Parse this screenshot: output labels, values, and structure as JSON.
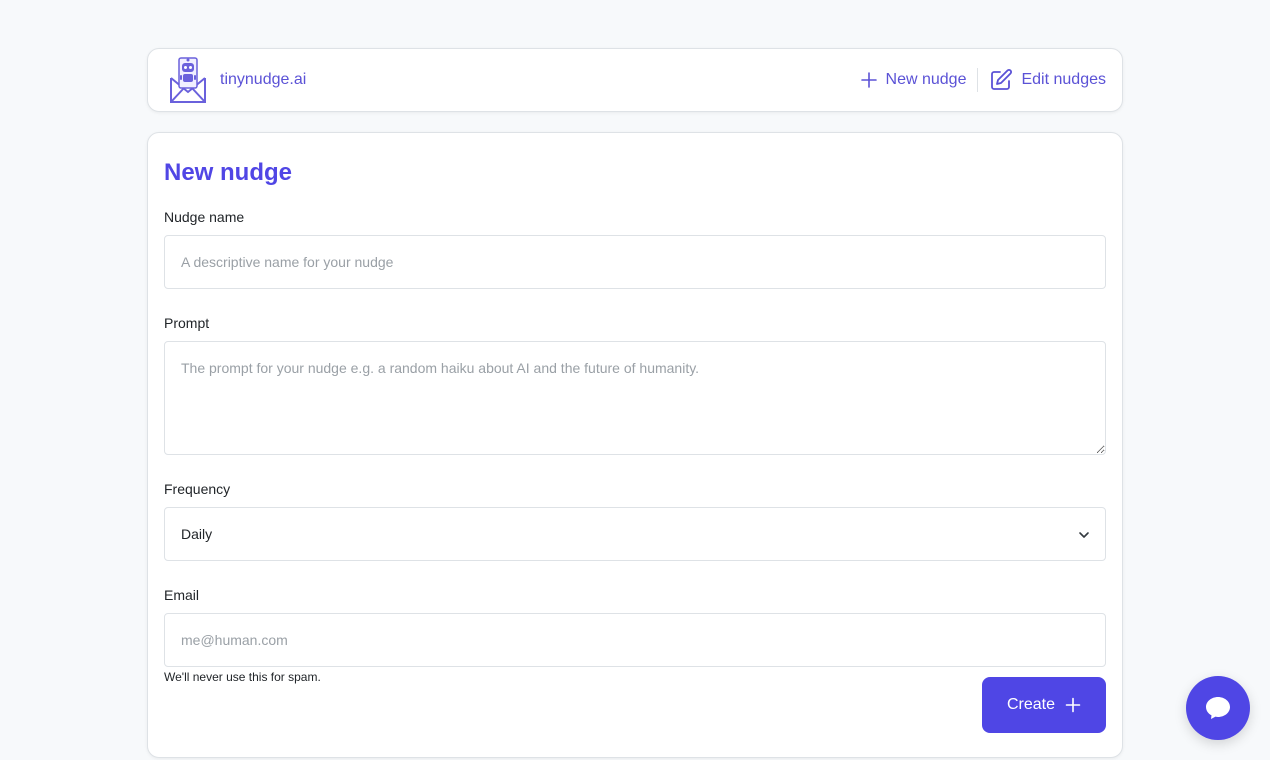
{
  "brand": {
    "name": "tinynudge.ai",
    "logo_icon": "robot-envelope-icon"
  },
  "nav": {
    "new_nudge": "New nudge",
    "edit_nudges": "Edit nudges"
  },
  "form": {
    "title": "New nudge",
    "name_label": "Nudge name",
    "name_placeholder": "A descriptive name for your nudge",
    "prompt_label": "Prompt",
    "prompt_placeholder": "The prompt for your nudge e.g. a random haiku about AI and the future of humanity.",
    "frequency_label": "Frequency",
    "frequency_value": "Daily",
    "email_label": "Email",
    "email_placeholder": "me@human.com",
    "email_help": "We'll never use this for spam.",
    "submit_label": "Create"
  },
  "colors": {
    "accent": "#4f46e5",
    "brand_text": "#5b52d6",
    "background": "#f7f9fb"
  },
  "chat": {
    "icon": "chat-bubble-icon"
  }
}
